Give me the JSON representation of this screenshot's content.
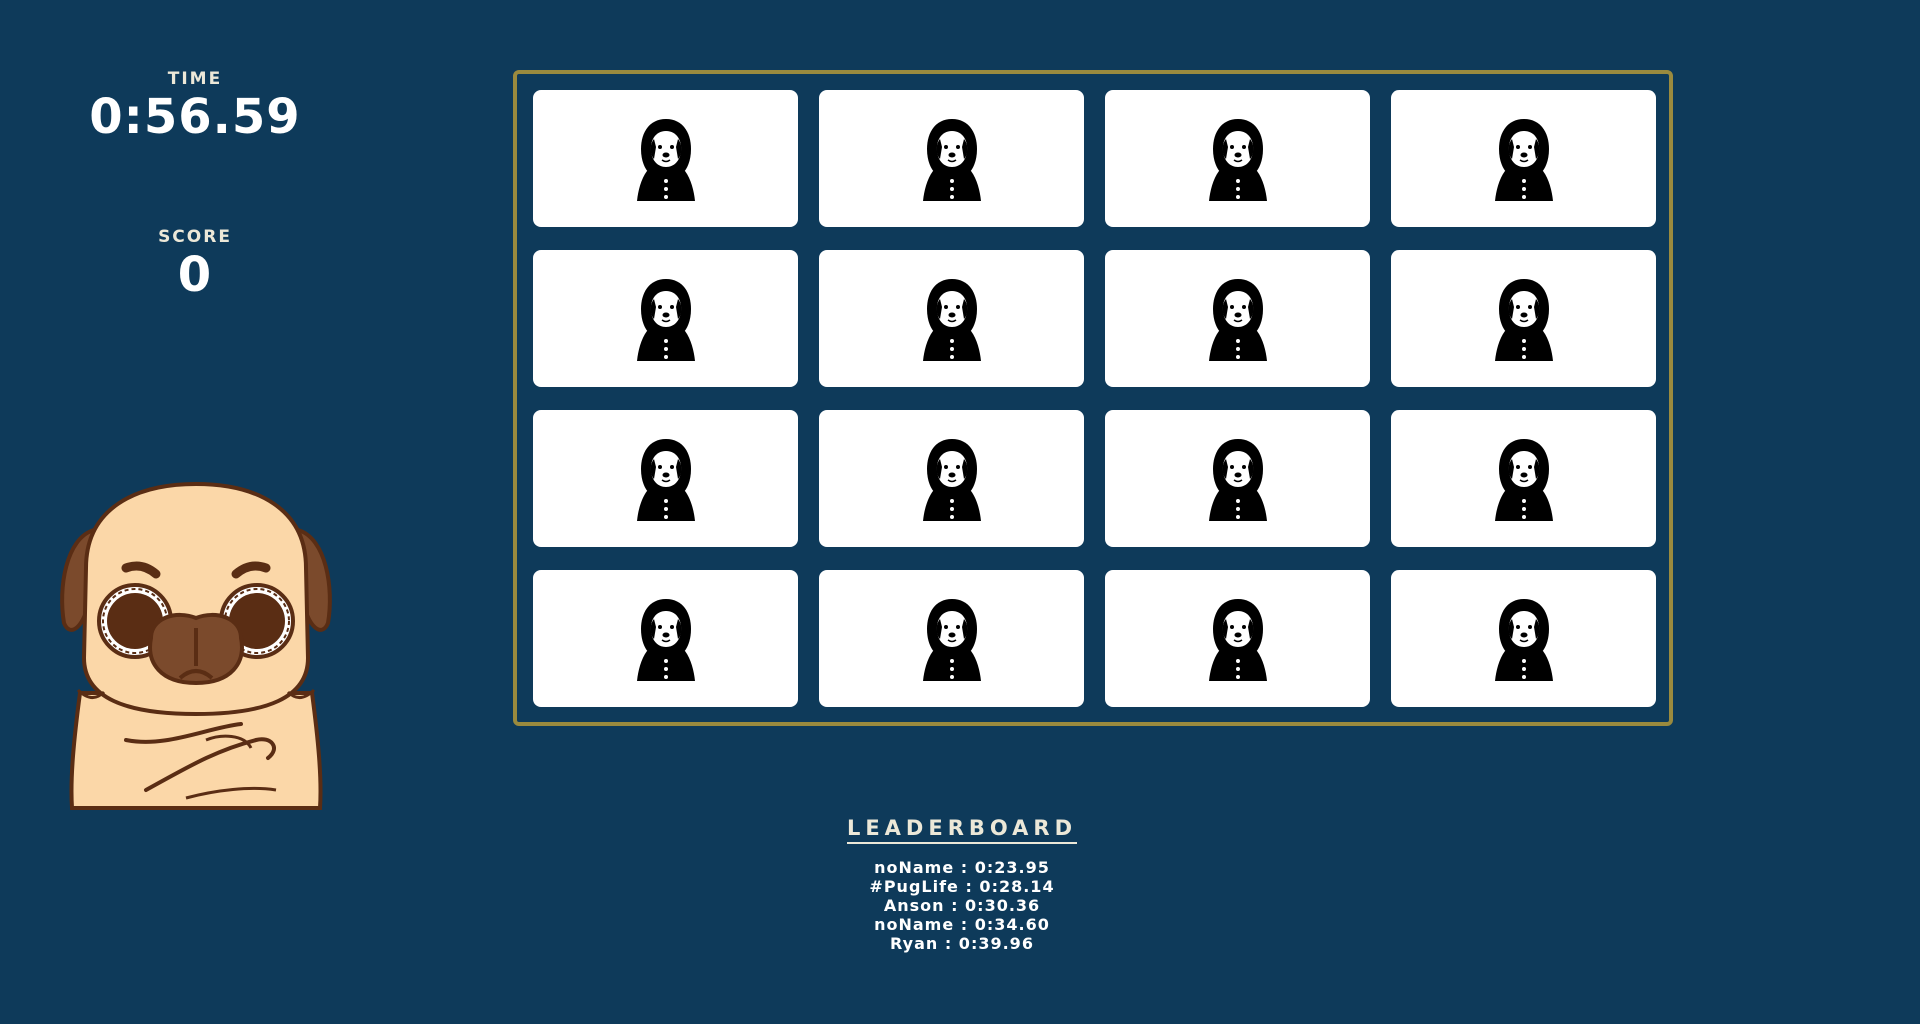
{
  "stats": {
    "time_label": "TIME",
    "time_value": "0:56.59",
    "score_label": "SCORE",
    "score_value": "0"
  },
  "board": {
    "card_icon": "hooded-dog-icon",
    "card_count": 16,
    "cards": [
      {
        "state": "face-down"
      },
      {
        "state": "face-down"
      },
      {
        "state": "face-down"
      },
      {
        "state": "face-down"
      },
      {
        "state": "face-down"
      },
      {
        "state": "face-down"
      },
      {
        "state": "face-down"
      },
      {
        "state": "face-down"
      },
      {
        "state": "face-down"
      },
      {
        "state": "face-down"
      },
      {
        "state": "face-down"
      },
      {
        "state": "face-down"
      },
      {
        "state": "face-down"
      },
      {
        "state": "face-down"
      },
      {
        "state": "face-down"
      },
      {
        "state": "face-down"
      }
    ]
  },
  "leaderboard": {
    "title": "LEADERBOARD",
    "entries": [
      "noName : 0:23.95",
      "#PugLife : 0:28.14",
      "Anson : 0:30.36",
      "noName : 0:34.60",
      "Ryan : 0:39.96"
    ]
  },
  "colors": {
    "background": "#0e3a5a",
    "board_border": "#9a8a3e",
    "card": "#ffffff",
    "label": "#ece8d8"
  }
}
